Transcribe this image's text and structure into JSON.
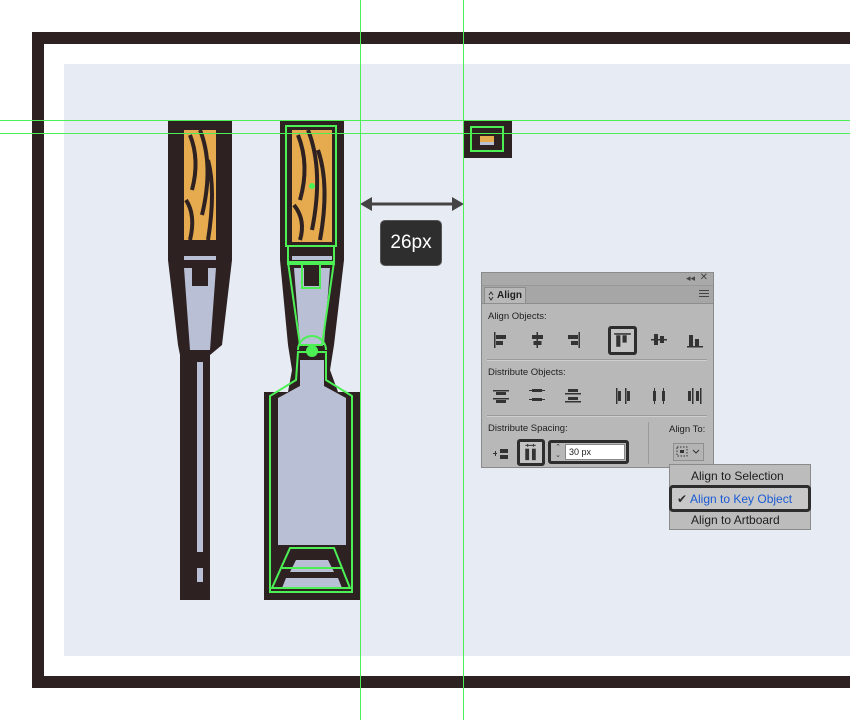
{
  "canvas": {
    "measure_label": "26px"
  },
  "align_panel": {
    "tab_label": "Align",
    "collapse_glyph": "◂◂",
    "close_glyph": "✕",
    "align_objects_label": "Align Objects:",
    "distribute_objects_label": "Distribute Objects:",
    "distribute_spacing_label": "Distribute Spacing:",
    "align_to_label": "Align To:",
    "spacing_value": "30 px",
    "spin_up": "⌃",
    "spin_down": "⌄"
  },
  "align_to_menu": {
    "items": [
      {
        "label": "Align to Selection",
        "checked": false
      },
      {
        "label": "Align to Key Object",
        "checked": true
      },
      {
        "label": "Align to Artboard",
        "checked": false
      }
    ],
    "check_glyph": "✔"
  },
  "colors": {
    "outline": "#2d2122",
    "wood": "#e7ab4f",
    "blade": "#b9bfd4",
    "guide": "#4cf055",
    "selected_text": "#1b5bd6"
  }
}
